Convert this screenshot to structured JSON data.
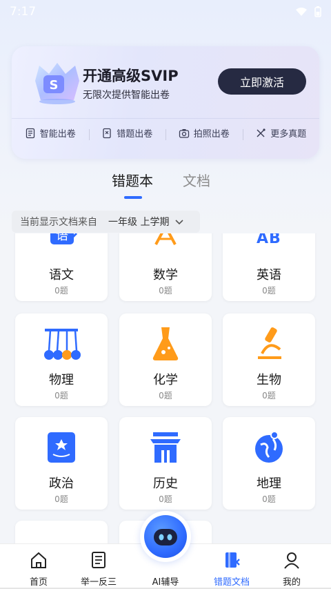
{
  "status_bar": {
    "time": "7:17"
  },
  "vip": {
    "title": "开通高级SVIP",
    "subtitle": "无限次提供智能出卷",
    "activate_label": "立即激活",
    "actions": [
      {
        "label": "智能出卷",
        "icon": "paper-icon"
      },
      {
        "label": "错题出卷",
        "icon": "wrong-paper-icon"
      },
      {
        "label": "拍照出卷",
        "icon": "camera-icon"
      },
      {
        "label": "更多真题",
        "icon": "more-icon"
      }
    ]
  },
  "tabs": {
    "active": "错题本",
    "inactive": "文档"
  },
  "source": {
    "label": "当前显示文档来自",
    "grade": "一年级 上学期"
  },
  "subjects": [
    {
      "name": "语文",
      "count": "0题",
      "icon": "chinese-icon"
    },
    {
      "name": "数学",
      "count": "0题",
      "icon": "math-icon"
    },
    {
      "name": "英语",
      "count": "0题",
      "icon": "english-icon"
    },
    {
      "name": "物理",
      "count": "0题",
      "icon": "physics-icon"
    },
    {
      "name": "化学",
      "count": "0题",
      "icon": "chemistry-icon"
    },
    {
      "name": "生物",
      "count": "0题",
      "icon": "biology-icon"
    },
    {
      "name": "政治",
      "count": "0题",
      "icon": "politics-icon"
    },
    {
      "name": "历史",
      "count": "0题",
      "icon": "history-icon"
    },
    {
      "name": "地理",
      "count": "0题",
      "icon": "geography-icon"
    }
  ],
  "nav": {
    "items": [
      {
        "label": "首页",
        "icon": "home-icon"
      },
      {
        "label": "举一反三",
        "icon": "book-icon"
      },
      {
        "label": "AI辅导",
        "icon": "robot-icon"
      },
      {
        "label": "错题文档",
        "icon": "wrong-doc-icon",
        "active": true
      },
      {
        "label": "我的",
        "icon": "profile-icon"
      }
    ]
  },
  "colors": {
    "accent": "#2f6bff",
    "orange": "#ff9b1a",
    "dark_button": "#262a42"
  }
}
